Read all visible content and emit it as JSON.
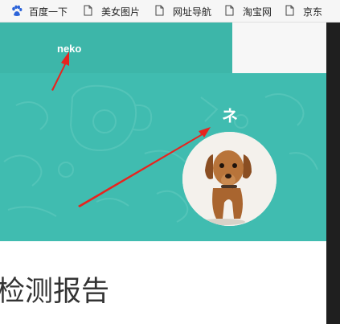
{
  "bookmarks": [
    {
      "label": "百度一下",
      "icon": "baidu-icon"
    },
    {
      "label": "美女图片",
      "icon": "document-icon"
    },
    {
      "label": "网址导航",
      "icon": "document-icon"
    },
    {
      "label": "淘宝网",
      "icon": "document-icon"
    },
    {
      "label": "京东",
      "icon": "document-icon"
    }
  ],
  "header": {
    "brand": "neko"
  },
  "banner": {
    "kana": "ネ",
    "avatar": "dachshund-dog-photo"
  },
  "page": {
    "title": "检测报告"
  },
  "colors": {
    "teal": "#3db6a9",
    "banner": "#40bcb0",
    "arrow": "#e8231e"
  }
}
